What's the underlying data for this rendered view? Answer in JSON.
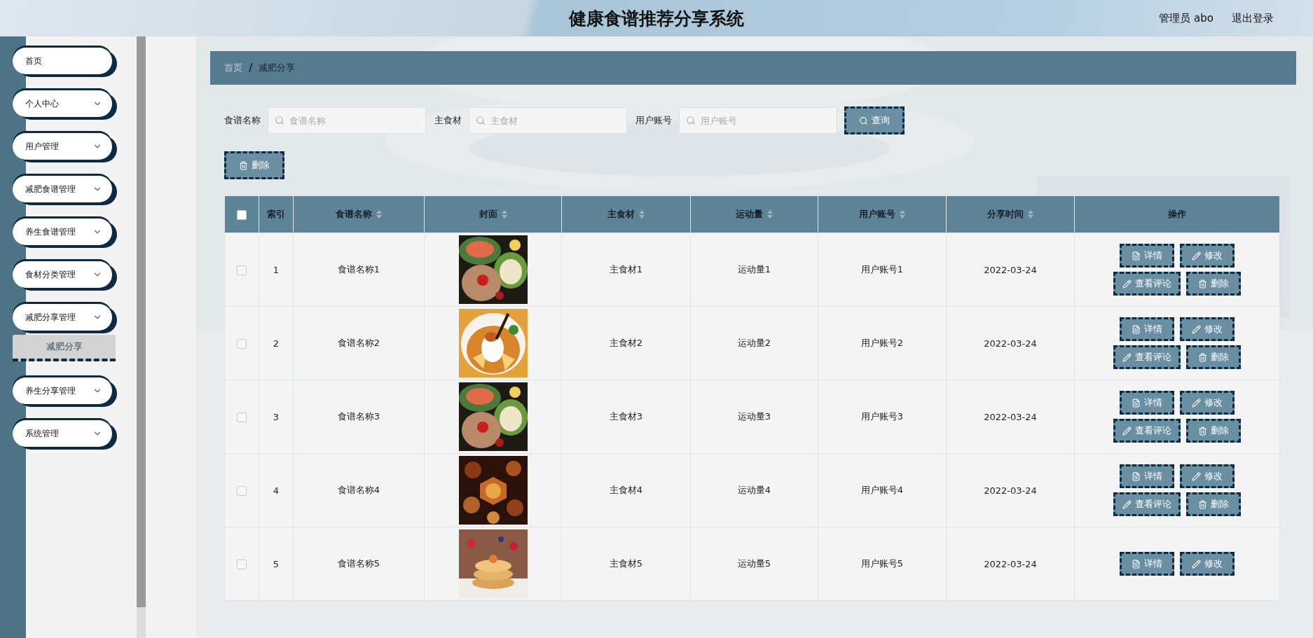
{
  "header": {
    "title": "健康食谱推荐分享系统",
    "user": "管理员 abo",
    "logout": "退出登录"
  },
  "sidebar": {
    "items": [
      {
        "label": "首页",
        "kind": "link"
      },
      {
        "label": "个人中心",
        "kind": "menu"
      },
      {
        "label": "用户管理",
        "kind": "menu"
      },
      {
        "label": "减肥食谱管理",
        "kind": "menu"
      },
      {
        "label": "养生食谱管理",
        "kind": "menu"
      },
      {
        "label": "食材分类管理",
        "kind": "menu"
      },
      {
        "label": "减肥分享管理",
        "kind": "menu",
        "children": [
          {
            "label": "减肥分享",
            "selected": true
          }
        ]
      },
      {
        "label": "养生分享管理",
        "kind": "menu"
      },
      {
        "label": "系统管理",
        "kind": "menu"
      }
    ]
  },
  "breadcrumb": {
    "items": [
      "首页",
      "减肥分享"
    ],
    "separator": "/"
  },
  "search": {
    "fields": [
      {
        "label": "食谱名称",
        "placeholder": "食谱名称"
      },
      {
        "label": "主食材",
        "placeholder": "主食材"
      },
      {
        "label": "用户账号",
        "placeholder": "用户账号"
      }
    ],
    "button": "查询"
  },
  "toolbar": {
    "delete_button": "删除"
  },
  "table": {
    "header_checked": false,
    "columns": [
      {
        "label": "索引",
        "sortable": false
      },
      {
        "label": "食谱名称",
        "sortable": true
      },
      {
        "label": "封面",
        "sortable": true
      },
      {
        "label": "主食材",
        "sortable": true
      },
      {
        "label": "运动量",
        "sortable": true
      },
      {
        "label": "用户账号",
        "sortable": true
      },
      {
        "label": "分享时间",
        "sortable": true
      },
      {
        "label": "操作",
        "sortable": false
      }
    ],
    "rows": [
      {
        "checked": false,
        "index": "1",
        "name": "食谱名称1",
        "cover": {
          "kind": "picture"
        },
        "ingredient": "主食材1",
        "exercise": "运动量1",
        "account": "用户账号1",
        "time": "2022-03-24",
        "actions": [
          {
            "label": "详情",
            "kind": "detail"
          },
          {
            "label": "修改",
            "kind": "edit"
          },
          {
            "label": "查看评论",
            "kind": "comment"
          },
          {
            "label": "删除",
            "kind": "delete"
          }
        ]
      },
      {
        "checked": false,
        "index": "2",
        "name": "食谱名称2",
        "cover": {
          "kind": "picture"
        },
        "ingredient": "主食材2",
        "exercise": "运动量2",
        "account": "用户账号2",
        "time": "2022-03-24",
        "actions": [
          {
            "label": "详情",
            "kind": "detail"
          },
          {
            "label": "修改",
            "kind": "edit"
          },
          {
            "label": "查看评论",
            "kind": "comment"
          },
          {
            "label": "删除",
            "kind": "delete"
          }
        ]
      },
      {
        "checked": false,
        "index": "3",
        "name": "食谱名称3",
        "cover": {
          "kind": "picture"
        },
        "ingredient": "主食材3",
        "exercise": "运动量3",
        "account": "用户账号3",
        "time": "2022-03-24",
        "actions": [
          {
            "label": "详情",
            "kind": "detail"
          },
          {
            "label": "修改",
            "kind": "edit"
          },
          {
            "label": "查看评论",
            "kind": "comment"
          },
          {
            "label": "删除",
            "kind": "delete"
          }
        ]
      },
      {
        "checked": false,
        "index": "4",
        "name": "食谱名称4",
        "cover": {
          "kind": "picture"
        },
        "ingredient": "主食材4",
        "exercise": "运动量4",
        "account": "用户账号4",
        "time": "2022-03-24",
        "actions": [
          {
            "label": "详情",
            "kind": "detail"
          },
          {
            "label": "修改",
            "kind": "edit"
          },
          {
            "label": "查看评论",
            "kind": "comment"
          },
          {
            "label": "删除",
            "kind": "delete"
          }
        ]
      },
      {
        "checked": false,
        "index": "5",
        "name": "食谱名称5",
        "cover": {
          "kind": "picture"
        },
        "ingredient": "主食材5",
        "exercise": "运动量5",
        "account": "用户账号5",
        "time": "2022-03-24",
        "actions": [
          {
            "label": "详情",
            "kind": "detail"
          },
          {
            "label": "修改",
            "kind": "edit"
          }
        ]
      }
    ]
  }
}
